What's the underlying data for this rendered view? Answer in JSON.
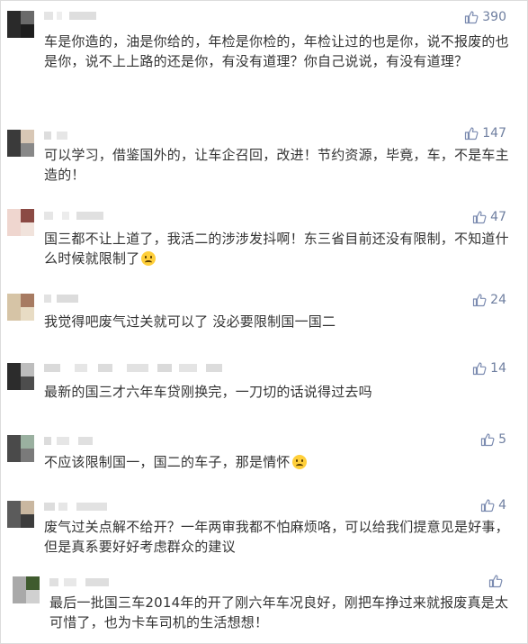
{
  "comments": [
    {
      "likes": "390",
      "text": "车是你造的，油是你给的，年检是你检的，年检让过的也是你，说不报废的也是你，说不上上路的还是你，有没有道理？你自己说说，有没有道理？"
    },
    {
      "likes": "147",
      "text": "可以学习，借鉴国外的，让车企召回，改进！节约资源，毕竟，车，不是车主造的！"
    },
    {
      "likes": "47",
      "text": "国三都不让上道了，我活二的涉涉发抖啊！东三省目前还没有限制，不知道什么时候就限制了"
    },
    {
      "likes": "24",
      "text": "我觉得吧废气过关就可以了 没必要限制国一国二"
    },
    {
      "likes": "14",
      "text": "最新的国三才六年车贷刚换完，一刀切的话说得过去吗"
    },
    {
      "likes": "5",
      "text": "不应该限制国一，国二的车子，那是情怀"
    },
    {
      "likes": "4",
      "text": "废气过关点解不给开？一年两审我都不怕麻烦咯，可以给我们提意见是好事，但是真系要好好考虑群众的建议"
    },
    {
      "likes": "",
      "text": "最后一批国三车2014年的开了刚六年车况良好，刚把车挣过来就报废真是太可惜了，也为卡车司机的生活想想！"
    }
  ],
  "emoji_names": [
    "crying-emoji",
    "smile-emoji"
  ],
  "colors": {
    "text": "#333333",
    "likes": "#6f7fa0",
    "border": "#dcdcdc"
  }
}
